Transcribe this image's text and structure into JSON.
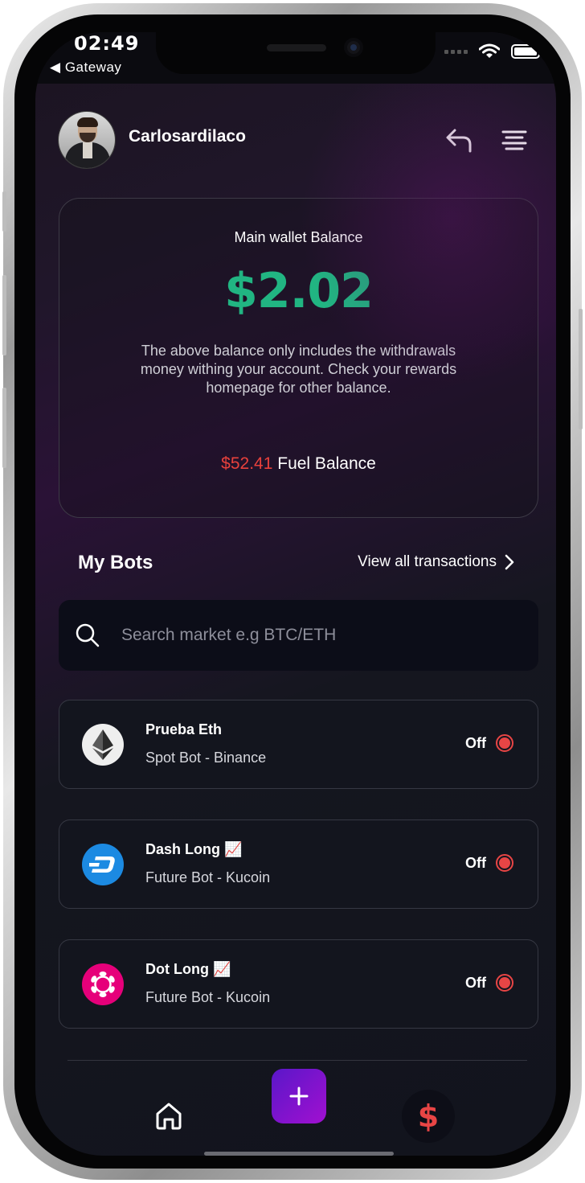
{
  "status_bar": {
    "time": "02:49",
    "back_app": "Gateway"
  },
  "header": {
    "username": "Carlosardilaco"
  },
  "wallet": {
    "title": "Main wallet Balance",
    "amount": "$2.02",
    "note": "The above balance only includes the withdrawals money withing your account. Check your rewards homepage for other balance.",
    "fuel_amount": "$52.41",
    "fuel_label": "Fuel Balance"
  },
  "bots_section": {
    "title": "My Bots",
    "view_all": "View all transactions"
  },
  "search": {
    "placeholder": "Search market e.g BTC/ETH"
  },
  "bots": [
    {
      "name": "Prueba Eth",
      "sub": "Spot Bot - Binance",
      "status": "Off",
      "coin_icon": "ethereum-icon"
    },
    {
      "name": "Dash Long 📈",
      "sub": "Future Bot - Kucoin",
      "status": "Off",
      "coin_icon": "dash-icon"
    },
    {
      "name": "Dot Long 📈",
      "sub": "Future Bot - Kucoin",
      "status": "Off",
      "coin_icon": "polkadot-icon"
    }
  ],
  "tab_bar": {
    "money_symbol": "$"
  },
  "colors": {
    "balance_green": "#21b582",
    "fuel_red": "#e8413c",
    "status_red": "#e84545",
    "add_button_gradient": [
      "#5a17c9",
      "#a110d0"
    ]
  }
}
